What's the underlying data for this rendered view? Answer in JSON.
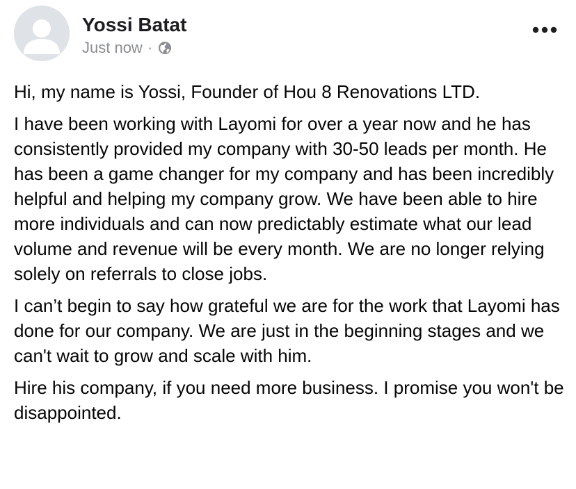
{
  "post": {
    "author": {
      "name": "Yossi Batat",
      "avatar_icon": "default-profile-avatar-icon"
    },
    "meta": {
      "timestamp": "Just now",
      "separator": "·",
      "audience_icon": "globe-icon"
    },
    "more_menu_icon": "ellipsis-more-icon",
    "paragraphs": [
      "Hi, my name is Yossi, Founder of Hou 8 Renovations LTD.",
      "I have been working with Layomi for over a year now and he has consistently provided my company with 30-50 leads per month. He has been a game changer for my company and has been incredibly helpful and helping my company grow. We have been able to hire more individuals and can now predictably estimate what our lead volume and revenue will be every month. We are no longer relying solely on referrals to close jobs.",
      "I can’t begin to say how grateful we are for the work that Layomi has done for our company. We are just in the beginning stages and we can't wait to grow and scale with him.",
      "Hire his company, if you need more business. I promise you won't be disappointed."
    ]
  },
  "colors": {
    "text_primary": "#050505",
    "text_secondary": "#8a8d91",
    "avatar_bg": "#dfe2e6",
    "avatar_fg": "#ffffff"
  }
}
